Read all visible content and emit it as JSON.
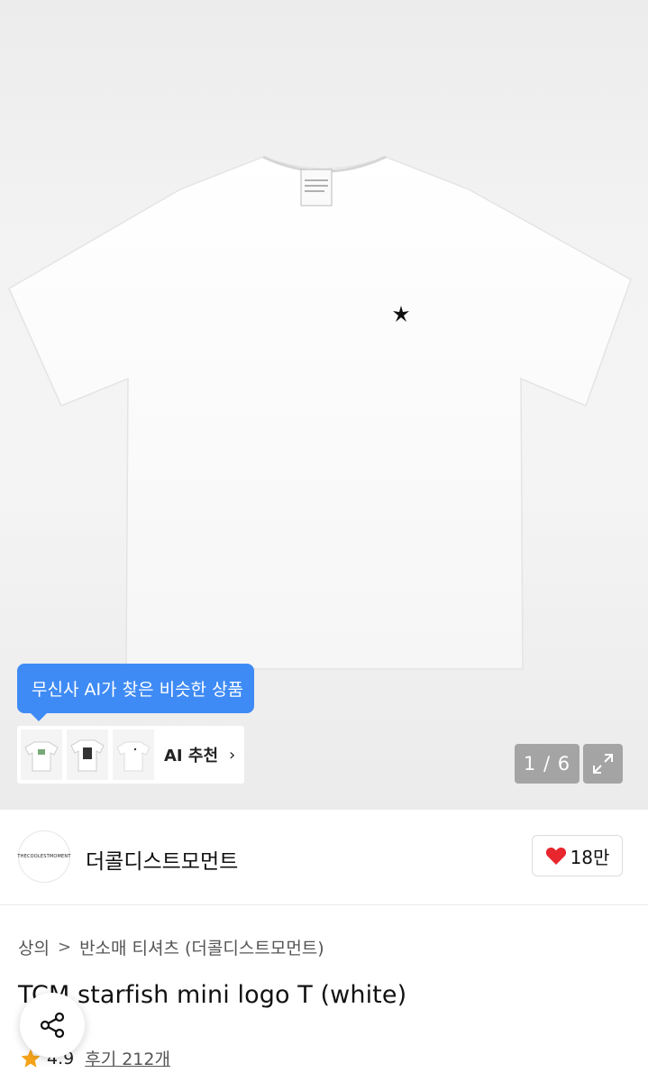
{
  "gallery": {
    "ai_bubble_text": "무신사 AI가 찾은 비슷한 상품",
    "ai_recommend_label": "AI 추천",
    "ai_recommend_chevron": "›",
    "counter_text": "1 / 6",
    "icons": {
      "expand": "expand-icon",
      "chevron": "chevron-right-icon"
    }
  },
  "brand": {
    "logo_text": "THECOOLESTMOMENT",
    "name": "더콜디스트모먼트",
    "like_count": "18만",
    "like_icon": "heart-icon",
    "like_color": "#e8262e"
  },
  "breadcrumb": {
    "items": [
      "상의",
      "반소매 티셔츠 (더콜디스트모먼트)"
    ],
    "separator": ">"
  },
  "product": {
    "title": "TCM starfish mini logo T (white)",
    "rating": "4.9",
    "reviews": "후기 212개",
    "star_color": "#f5a31a"
  },
  "share": {
    "icon": "share-icon"
  }
}
